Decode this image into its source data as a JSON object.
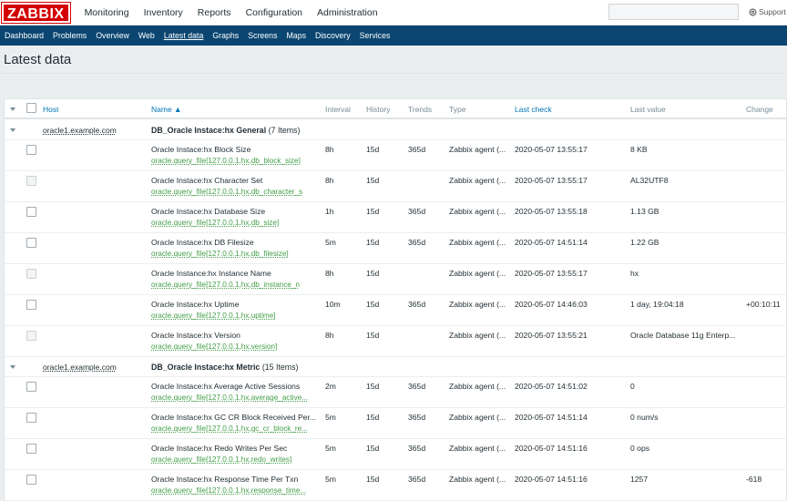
{
  "header": {
    "logo": "ZABBIX",
    "menu": [
      "Monitoring",
      "Inventory",
      "Reports",
      "Configuration",
      "Administration"
    ],
    "search_value": "",
    "support_label": "Support"
  },
  "submenu": [
    "Dashboard",
    "Problems",
    "Overview",
    "Web",
    "Latest data",
    "Graphs",
    "Screens",
    "Maps",
    "Discovery",
    "Services"
  ],
  "page": {
    "title": "Latest data"
  },
  "table": {
    "columns": {
      "host": "Host",
      "name": "Name ▲",
      "interval": "Interval",
      "history": "History",
      "trends": "Trends",
      "type": "Type",
      "last_check": "Last check",
      "last_value": "Last value",
      "change": "Change"
    },
    "groups": [
      {
        "host": "oracle1.example.com",
        "app": "DB_Oracle Instace:hx General",
        "count": "(7 Items)",
        "items": [
          {
            "name": "Oracle Instace:hx Block Size",
            "key": "oracle.query_file[127.0.0.1,hx,db_block_size]",
            "interval": "8h",
            "history": "15d",
            "trends": "365d",
            "type": "Zabbix agent (...",
            "last_check": "2020-05-07 13:55:17",
            "last_value": "8 KB",
            "change": ""
          },
          {
            "name": "Oracle Instace:hx Character Set",
            "key": "oracle.query_file[127.0.0.1,hx,db_character_s",
            "interval": "8h",
            "history": "15d",
            "trends": "",
            "type": "Zabbix agent (...",
            "last_check": "2020-05-07 13:55:17",
            "last_value": "AL32UTF8",
            "change": ""
          },
          {
            "name": "Oracle Instace:hx Database Size",
            "key": "oracle.query_file[127.0.0.1,hx,db_size]",
            "interval": "1h",
            "history": "15d",
            "trends": "365d",
            "type": "Zabbix agent (...",
            "last_check": "2020-05-07 13:55:18",
            "last_value": "1.13 GB",
            "change": ""
          },
          {
            "name": "Oracle Instace:hx DB Filesize",
            "key": "oracle.query_file[127.0.0.1,hx,db_filesize]",
            "interval": "5m",
            "history": "15d",
            "trends": "365d",
            "type": "Zabbix agent (...",
            "last_check": "2020-05-07 14:51:14",
            "last_value": "1.22 GB",
            "change": ""
          },
          {
            "name": "Oracle Instance:hx Instance Name",
            "key": "oracle.query_file[127.0.0.1,hx,db_instance_n",
            "interval": "8h",
            "history": "15d",
            "trends": "",
            "type": "Zabbix agent (...",
            "last_check": "2020-05-07 13:55:17",
            "last_value": "hx",
            "change": ""
          },
          {
            "name": "Oracle Instace:hx Uptime",
            "key": "oracle.query_file[127.0.0.1,hx,uptime]",
            "interval": "10m",
            "history": "15d",
            "trends": "365d",
            "type": "Zabbix agent (...",
            "last_check": "2020-05-07 14:46:03",
            "last_value": "1 day, 19:04:18",
            "change": "+00:10:11"
          },
          {
            "name": "Oracle Instace:hx Version",
            "key": "oracle.query_file[127.0.0.1,hx,version]",
            "interval": "8h",
            "history": "15d",
            "trends": "",
            "type": "Zabbix agent (...",
            "last_check": "2020-05-07 13:55:21",
            "last_value": "Oracle Database 11g Enterp...",
            "change": ""
          }
        ]
      },
      {
        "host": "oracle1.example.com",
        "app": "DB_Oracle Instace:hx Metric",
        "count": "(15 Items)",
        "items": [
          {
            "name": "Oracle Instace:hx Average Active Sessions",
            "key": "oracle.query_file[127.0.0.1,hx,average_active...",
            "interval": "2m",
            "history": "15d",
            "trends": "365d",
            "type": "Zabbix agent (...",
            "last_check": "2020-05-07 14:51:02",
            "last_value": "0",
            "change": ""
          },
          {
            "name": "Oracle Instace:hx GC CR Block Received Per...",
            "key": "oracle.query_file[127.0.0.1,hx,gc_cr_block_re...",
            "interval": "5m",
            "history": "15d",
            "trends": "365d",
            "type": "Zabbix agent (...",
            "last_check": "2020-05-07 14:51:14",
            "last_value": "0 num/s",
            "change": ""
          },
          {
            "name": "Oracle Instace:hx Redo Writes Per Sec",
            "key": "oracle.query_file[127.0.0.1,hx,redo_writes]",
            "interval": "5m",
            "history": "15d",
            "trends": "365d",
            "type": "Zabbix agent (...",
            "last_check": "2020-05-07 14:51:16",
            "last_value": "0 ops",
            "change": ""
          },
          {
            "name": "Oracle Instace:hx Response Time Per Txn",
            "key": "oracle.query_file[127.0.0.1,hx,response_time...",
            "interval": "5m",
            "history": "15d",
            "trends": "365d",
            "type": "Zabbix agent (...",
            "last_check": "2020-05-07 14:51:16",
            "last_value": "1257",
            "change": "-618"
          }
        ]
      }
    ]
  }
}
